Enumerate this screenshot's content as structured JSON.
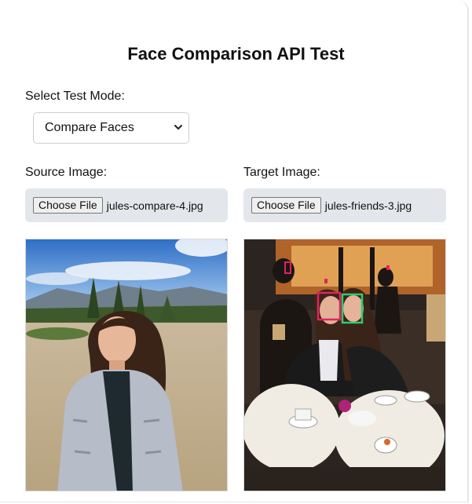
{
  "page": {
    "title": "Face Comparison API Test"
  },
  "mode": {
    "label": "Select Test Mode:",
    "selected": "Compare Faces"
  },
  "source": {
    "label": "Source Image:",
    "button": "Choose File",
    "filename": "jules-compare-4.jpg"
  },
  "target": {
    "label": "Target Image:",
    "button": "Choose File",
    "filename": "jules-friends-3.jpg"
  },
  "colors": {
    "face_box_pink": "#e0245e",
    "face_box_green": "#2ecc71",
    "input_bg": "#e3e6ea"
  }
}
